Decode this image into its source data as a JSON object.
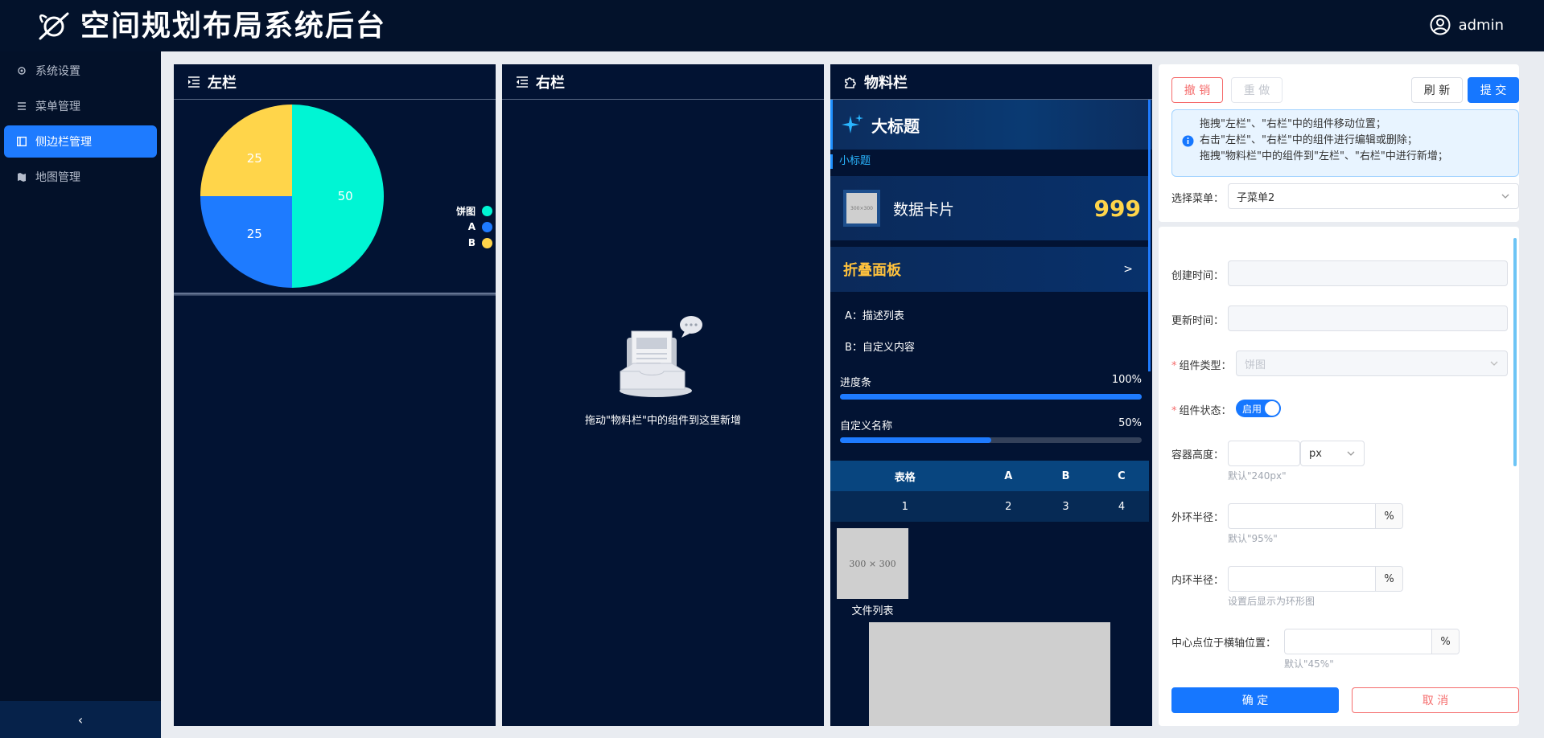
{
  "header": {
    "title": "空间规划布局系统后台",
    "user": "admin"
  },
  "sidebar": {
    "items": [
      {
        "label": "系统设置",
        "icon": "gear-icon"
      },
      {
        "label": "菜单管理",
        "icon": "list-icon"
      },
      {
        "label": "侧边栏管理",
        "icon": "sidebar-icon",
        "active": true
      },
      {
        "label": "地图管理",
        "icon": "map-icon"
      }
    ],
    "collapse": "‹"
  },
  "left_panel": {
    "title": "左栏"
  },
  "right_panel": {
    "title": "右栏",
    "empty_text": "拖动\"物料栏\"中的组件到这里新增"
  },
  "chart_data": {
    "type": "pie",
    "legend": [
      "饼图",
      "A",
      "B"
    ],
    "legend_colors": [
      "#00f5d4",
      "#1e7bff",
      "#ffd54a"
    ],
    "slices": [
      {
        "name": "饼图",
        "value": 50,
        "color": "#00f5d4"
      },
      {
        "name": "A",
        "value": 25,
        "color": "#1e7bff"
      },
      {
        "name": "B",
        "value": 25,
        "color": "#ffd54a"
      }
    ],
    "legend_position": "right"
  },
  "material_panel": {
    "title": "物料栏",
    "big_title": "大标题",
    "small_title": "小标题",
    "data_card": {
      "label": "数据卡片",
      "value": "999",
      "img_text": "300×300"
    },
    "collapse_title": "折叠面板",
    "desc_items": [
      "A：描述列表",
      "B：自定义内容"
    ],
    "progress": [
      {
        "label": "进度条",
        "value_text": "100%",
        "value": 100
      },
      {
        "label": "自定义名称",
        "value_text": "50%",
        "value": 50
      }
    ],
    "table": {
      "headers": [
        "表格",
        "A",
        "B",
        "C"
      ],
      "rows": [
        [
          "1",
          "2",
          "3",
          "4"
        ]
      ]
    },
    "file_list": {
      "thumb": "300 × 300",
      "label": "文件列表"
    }
  },
  "toolbar": {
    "undo": "撤 销",
    "redo": "重 做",
    "refresh": "刷 新",
    "submit": "提 交"
  },
  "tips": [
    "拖拽\"左栏\"、\"右栏\"中的组件移动位置；",
    "右击\"左栏\"、\"右栏\"中的组件进行编辑或删除；",
    "拖拽\"物料栏\"中的组件到\"左栏\"、\"右栏\"中进行新增；"
  ],
  "menu_select": {
    "label": "选择菜单：",
    "value": "子菜单2"
  },
  "form": {
    "created_label": "创建时间：",
    "updated_label": "更新时间：",
    "type_label": "组件类型：",
    "type_value": "饼图",
    "status_label": "组件状态：",
    "status_value": "启用",
    "height_label": "容器高度：",
    "height_unit": "px",
    "height_hint": "默认\"240px\"",
    "outer_label": "外环半径：",
    "outer_hint": "默认\"95%\"",
    "inner_label": "内环半径：",
    "inner_hint": "设置后显示为环形图",
    "center_label": "中心点位于横轴位置：",
    "center_hint": "默认\"45%\"",
    "percent": "%",
    "ok": "确 定",
    "cancel": "取 消"
  }
}
